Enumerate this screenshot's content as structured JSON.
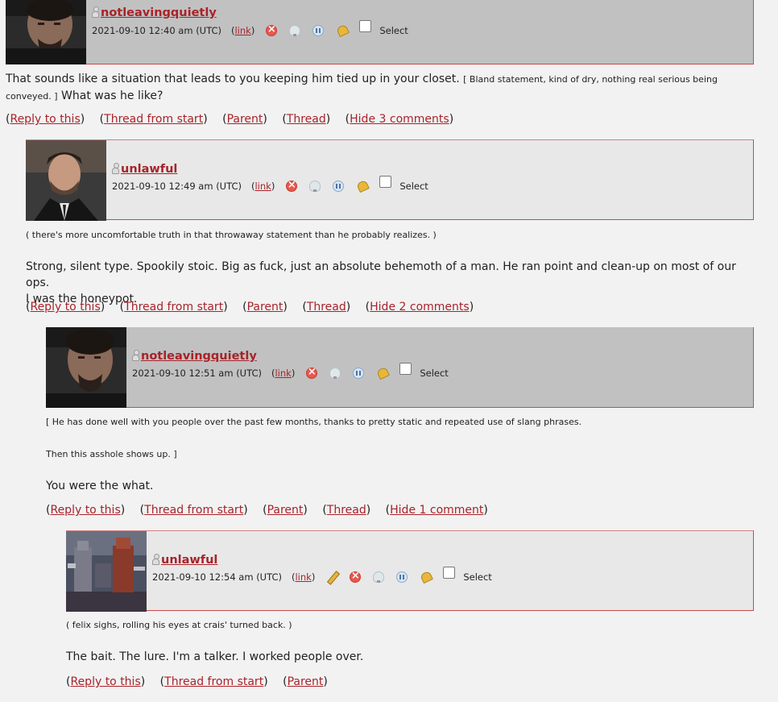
{
  "colors": {
    "accent": "#a8232a",
    "header_gray": "#c1c1c1",
    "header_light": "#e8e8e8"
  },
  "icons": [
    "user-icon",
    "delete-icon",
    "track-icon",
    "freeze-icon",
    "screen-icon",
    "edit-icon"
  ],
  "c1": {
    "user": "notleavingquietly",
    "time": "2021-09-10 12:40 am (UTC)",
    "link": "link",
    "select": "Select",
    "body_a": "That sounds like a situation that leads to you keeping him tied up in your closet.",
    "body_b": "[ Bland statement, kind of dry, nothing real serious being",
    "body_c": "conveyed. ]",
    "body_d": "What was he like?",
    "links": {
      "reply": "Reply to this",
      "thread_start": "Thread from start",
      "parent": "Parent",
      "thread": "Thread",
      "hide": "Hide 3 comments"
    }
  },
  "c2": {
    "user": "unlawful",
    "time": "2021-09-10 12:49 am (UTC)",
    "link": "link",
    "select": "Select",
    "body_a": "( there's more uncomfortable truth in that throwaway statement than he probably realizes. )",
    "body_b": "Strong, silent type. Spookily stoic. Big as fuck, just an absolute behemoth of a man. He ran point and clean-up on most of our ops.",
    "body_c": "I was the honeypot.",
    "links": {
      "reply": "Reply to this",
      "thread_start": "Thread from start",
      "parent": "Parent",
      "thread": "Thread",
      "hide": "Hide 2 comments"
    }
  },
  "c3": {
    "user": "notleavingquietly",
    "time": "2021-09-10 12:51 am (UTC)",
    "link": "link",
    "select": "Select",
    "body_a": "[ He has done well with you people over the past few months, thanks to pretty static and repeated use of slang phrases.",
    "body_b": "Then this asshole shows up. ]",
    "body_c": "You were the what.",
    "links": {
      "reply": "Reply to this",
      "thread_start": "Thread from start",
      "parent": "Parent",
      "thread": "Thread",
      "hide": "Hide 1 comment"
    }
  },
  "c4": {
    "user": "unlawful",
    "time": "2021-09-10 12:54 am (UTC)",
    "link": "link",
    "select": "Select",
    "body_a": "( felix sighs, rolling his eyes at crais' turned back. )",
    "body_b": "The bait. The lure. I'm a talker. I worked people over.",
    "links": {
      "reply": "Reply to this",
      "thread_start": "Thread from start",
      "parent": "Parent"
    }
  }
}
